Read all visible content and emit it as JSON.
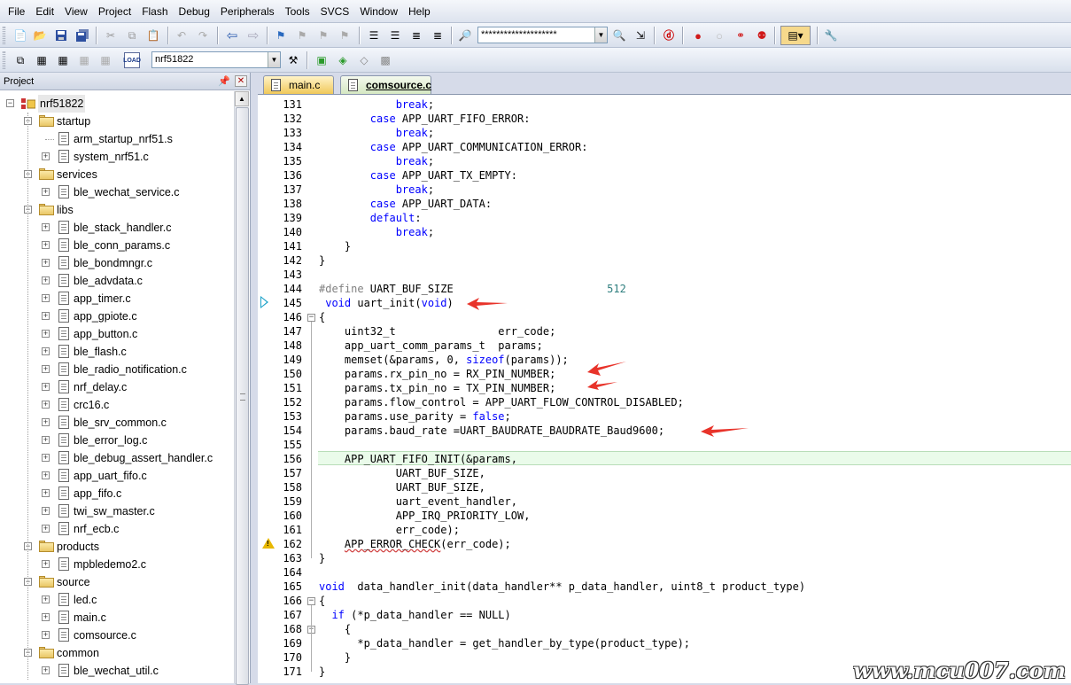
{
  "menu": [
    "File",
    "Edit",
    "View",
    "Project",
    "Flash",
    "Debug",
    "Peripherals",
    "Tools",
    "SVCS",
    "Window",
    "Help"
  ],
  "toolbar": {
    "find_combo_value": "********************",
    "target_combo_value": "nrf51822"
  },
  "project_panel": {
    "title": "Project",
    "pin_icon": "pin-icon",
    "close_icon": "close-icon",
    "root": "nrf51822",
    "tree": [
      {
        "label": "nrf51822",
        "type": "root",
        "depth": 0
      },
      {
        "label": "startup",
        "type": "folder",
        "depth": 1
      },
      {
        "label": "arm_startup_nrf51.s",
        "type": "file",
        "depth": 2,
        "expander": false
      },
      {
        "label": "system_nrf51.c",
        "type": "file",
        "depth": 2,
        "expander": true
      },
      {
        "label": "services",
        "type": "folder",
        "depth": 1
      },
      {
        "label": "ble_wechat_service.c",
        "type": "file",
        "depth": 2,
        "expander": true
      },
      {
        "label": "libs",
        "type": "folder",
        "depth": 1
      },
      {
        "label": "ble_stack_handler.c",
        "type": "file",
        "depth": 2,
        "expander": true
      },
      {
        "label": "ble_conn_params.c",
        "type": "file",
        "depth": 2,
        "expander": true
      },
      {
        "label": "ble_bondmngr.c",
        "type": "file",
        "depth": 2,
        "expander": true
      },
      {
        "label": "ble_advdata.c",
        "type": "file",
        "depth": 2,
        "expander": true
      },
      {
        "label": "app_timer.c",
        "type": "file",
        "depth": 2,
        "expander": true
      },
      {
        "label": "app_gpiote.c",
        "type": "file",
        "depth": 2,
        "expander": true
      },
      {
        "label": "app_button.c",
        "type": "file",
        "depth": 2,
        "expander": true
      },
      {
        "label": "ble_flash.c",
        "type": "file",
        "depth": 2,
        "expander": true
      },
      {
        "label": "ble_radio_notification.c",
        "type": "file",
        "depth": 2,
        "expander": true
      },
      {
        "label": "nrf_delay.c",
        "type": "file",
        "depth": 2,
        "expander": true
      },
      {
        "label": "crc16.c",
        "type": "file",
        "depth": 2,
        "expander": true
      },
      {
        "label": "ble_srv_common.c",
        "type": "file",
        "depth": 2,
        "expander": true
      },
      {
        "label": "ble_error_log.c",
        "type": "file",
        "depth": 2,
        "expander": true
      },
      {
        "label": "ble_debug_assert_handler.c",
        "type": "file",
        "depth": 2,
        "expander": true
      },
      {
        "label": "app_uart_fifo.c",
        "type": "file",
        "depth": 2,
        "expander": true
      },
      {
        "label": "app_fifo.c",
        "type": "file",
        "depth": 2,
        "expander": true
      },
      {
        "label": "twi_sw_master.c",
        "type": "file",
        "depth": 2,
        "expander": true
      },
      {
        "label": "nrf_ecb.c",
        "type": "file",
        "depth": 2,
        "expander": true
      },
      {
        "label": "products",
        "type": "folder",
        "depth": 1
      },
      {
        "label": "mpbledemo2.c",
        "type": "file",
        "depth": 2,
        "expander": true
      },
      {
        "label": "source",
        "type": "folder",
        "depth": 1
      },
      {
        "label": "led.c",
        "type": "file",
        "depth": 2,
        "expander": true
      },
      {
        "label": "main.c",
        "type": "file",
        "depth": 2,
        "expander": true
      },
      {
        "label": "comsource.c",
        "type": "file",
        "depth": 2,
        "expander": true
      },
      {
        "label": "common",
        "type": "folder",
        "depth": 1
      },
      {
        "label": "ble_wechat_util.c",
        "type": "file",
        "depth": 2,
        "expander": true
      }
    ]
  },
  "editor_tabs": [
    {
      "label": "main.c",
      "active": false
    },
    {
      "label": "comsource.c",
      "active": true
    }
  ],
  "code_lines": [
    {
      "n": "131",
      "text": "            break;",
      "fold": ""
    },
    {
      "n": "132",
      "text": "        case APP_UART_FIFO_ERROR:",
      "fold": ""
    },
    {
      "n": "133",
      "text": "            break;",
      "fold": ""
    },
    {
      "n": "134",
      "text": "        case APP_UART_COMMUNICATION_ERROR:",
      "fold": ""
    },
    {
      "n": "135",
      "text": "            break;",
      "fold": ""
    },
    {
      "n": "136",
      "text": "        case APP_UART_TX_EMPTY:",
      "fold": ""
    },
    {
      "n": "137",
      "text": "            break;",
      "fold": ""
    },
    {
      "n": "138",
      "text": "        case APP_UART_DATA:",
      "fold": ""
    },
    {
      "n": "139",
      "text": "        default:",
      "fold": ""
    },
    {
      "n": "140",
      "text": "            break;",
      "fold": ""
    },
    {
      "n": "141",
      "text": "    }",
      "fold": ""
    },
    {
      "n": "142",
      "text": "}",
      "fold": ""
    },
    {
      "n": "143",
      "text": "",
      "fold": ""
    },
    {
      "n": "144",
      "text": "#define UART_BUF_SIZE                        512",
      "fold": ""
    },
    {
      "n": "145",
      "text": " void uart_init(void)",
      "fold": ""
    },
    {
      "n": "146",
      "text": "{",
      "fold": "minus"
    },
    {
      "n": "147",
      "text": "    uint32_t                err_code;",
      "fold": ""
    },
    {
      "n": "148",
      "text": "    app_uart_comm_params_t  params;",
      "fold": ""
    },
    {
      "n": "149",
      "text": "    memset(&params, 0, sizeof(params));",
      "fold": ""
    },
    {
      "n": "150",
      "text": "    params.rx_pin_no = RX_PIN_NUMBER;",
      "fold": ""
    },
    {
      "n": "151",
      "text": "    params.tx_pin_no = TX_PIN_NUMBER;",
      "fold": ""
    },
    {
      "n": "152",
      "text": "    params.flow_control = APP_UART_FLOW_CONTROL_DISABLED;",
      "fold": ""
    },
    {
      "n": "153",
      "text": "    params.use_parity = false;",
      "fold": ""
    },
    {
      "n": "154",
      "text": "    params.baud_rate =UART_BAUDRATE_BAUDRATE_Baud9600;",
      "fold": ""
    },
    {
      "n": "155",
      "text": "",
      "fold": ""
    },
    {
      "n": "156",
      "text": "    APP_UART_FIFO_INIT(&params,",
      "fold": ""
    },
    {
      "n": "157",
      "text": "            UART_BUF_SIZE,",
      "fold": ""
    },
    {
      "n": "158",
      "text": "            UART_BUF_SIZE,",
      "fold": ""
    },
    {
      "n": "159",
      "text": "            uart_event_handler,",
      "fold": ""
    },
    {
      "n": "160",
      "text": "            APP_IRQ_PRIORITY_LOW,",
      "fold": ""
    },
    {
      "n": "161",
      "text": "            err_code);",
      "fold": ""
    },
    {
      "n": "162",
      "text": "    APP_ERROR_CHECK(err_code);",
      "fold": ""
    },
    {
      "n": "163",
      "text": "}",
      "fold": ""
    },
    {
      "n": "164",
      "text": "",
      "fold": ""
    },
    {
      "n": "165",
      "text": "void  data_handler_init(data_handler** p_data_handler, uint8_t product_type)",
      "fold": ""
    },
    {
      "n": "166",
      "text": "{",
      "fold": "minus"
    },
    {
      "n": "167",
      "text": "  if (*p_data_handler == NULL)",
      "fold": ""
    },
    {
      "n": "168",
      "text": "    {",
      "fold": "minus"
    },
    {
      "n": "169",
      "text": "      *p_data_handler = get_handler_by_type(product_type);",
      "fold": ""
    },
    {
      "n": "170",
      "text": "    }",
      "fold": ""
    },
    {
      "n": "171",
      "text": "}",
      "fold": ""
    }
  ],
  "watermark": "www.mcu007.com",
  "colors": {
    "keyword": "#0000ff",
    "preprocessor": "#808080",
    "number": "#2f7f7f",
    "annotation_arrow": "#e8332a"
  }
}
